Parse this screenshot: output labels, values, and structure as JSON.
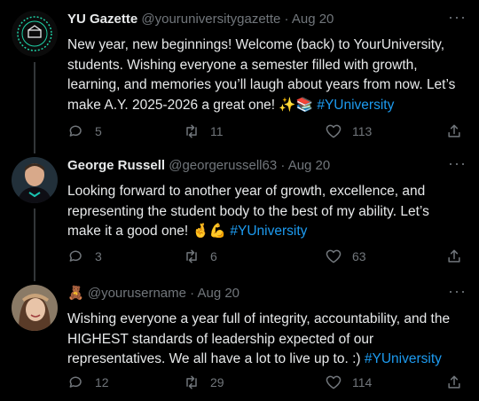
{
  "tweets": [
    {
      "name": "YU Gazette",
      "handle": "@youruniversitygazette",
      "separator": "·",
      "date": "Aug 20",
      "text": "New year, new beginnings! Welcome (back) to YourUniversity, students. Wishing everyone a semester filled with growth, learning, and memories you’ll laugh about years from now. Let’s make A.Y. 2025-2026 a great one! ✨📚",
      "hashtag": "#YUniversity",
      "replies": "5",
      "retweets": "11",
      "likes": "113",
      "more": "···"
    },
    {
      "name": "George Russell",
      "handle": "@georgerussell63",
      "separator": "·",
      "date": "Aug 20",
      "text": "Looking forward to another year of growth, excellence, and representing the student body to the best of my ability. Let’s make it a good one! 🤞💪",
      "hashtag": "#YUniversity",
      "replies": "3",
      "retweets": "6",
      "likes": "63",
      "more": "···"
    },
    {
      "name": "🧸",
      "handle": "@yourusername",
      "separator": "·",
      "date": "Aug 20",
      "text": "Wishing everyone a year full of integrity, accountability, and the HIGHEST standards of leadership expected of our representatives. We all have a lot to live up to. :)",
      "hashtag": "#YUniversity",
      "replies": "12",
      "retweets": "29",
      "likes": "114",
      "more": "···"
    }
  ],
  "colors": {
    "background": "#000000",
    "text": "#e7e9ea",
    "muted": "#71767b",
    "link": "#1d9bf0",
    "divider": "#2f3336"
  },
  "icons": [
    "reply-icon",
    "retweet-icon",
    "like-icon",
    "share-icon",
    "more-icon"
  ]
}
